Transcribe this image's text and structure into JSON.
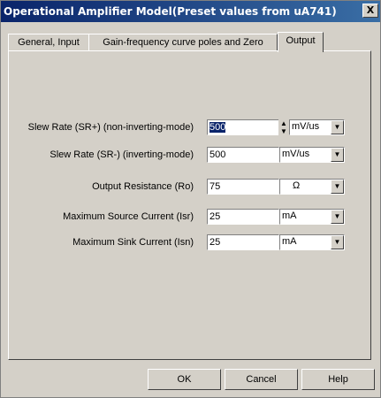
{
  "window": {
    "title": "Operational Amplifier Model(Preset values from uA741)",
    "close_label": "X"
  },
  "tabs": [
    {
      "label": "General, Input"
    },
    {
      "label": "Gain-frequency curve poles and Zero"
    },
    {
      "label": "Output"
    }
  ],
  "active_tab": "Output",
  "fields": [
    {
      "label": "Slew Rate (SR+) (non-inverting-mode)",
      "value": "500",
      "unit": "mV/us",
      "has_spinner": true,
      "selected": true
    },
    {
      "label": "Slew Rate (SR-) (inverting-mode)",
      "value": "500",
      "unit": "mV/us"
    },
    {
      "label": "Output Resistance (Ro)",
      "value": "75",
      "unit": "Ω"
    },
    {
      "label": "Maximum Source Current (Isr)",
      "value": "25",
      "unit": "mA"
    },
    {
      "label": "Maximum Sink Current (Isn)",
      "value": "25",
      "unit": "mA"
    }
  ],
  "icons": {
    "dropdown": "▼",
    "spin_up": "▲",
    "spin_down": "▼"
  },
  "buttons": {
    "ok": "OK",
    "cancel": "Cancel",
    "help": "Help"
  },
  "colors": {
    "titlebar_start": "#0a246a",
    "titlebar_end": "#3a6ea5",
    "face": "#d4d0c8",
    "selection": "#0a246a"
  }
}
